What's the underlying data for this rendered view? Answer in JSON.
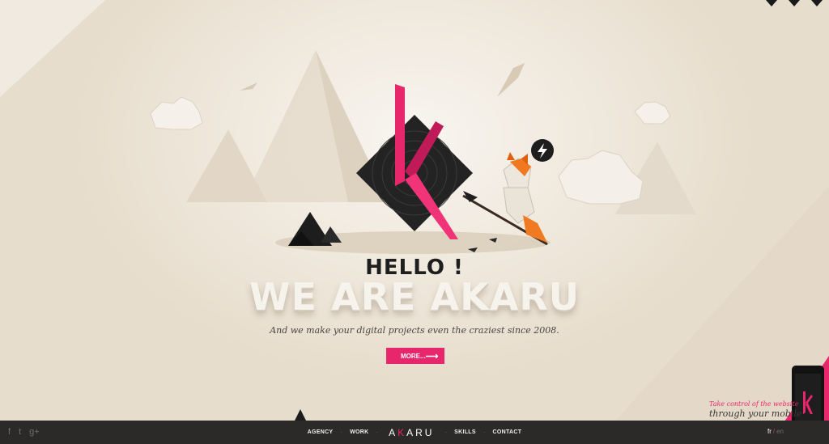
{
  "hero": {
    "greeting": "HELLO !",
    "headline": "WE ARE AKARU",
    "tagline": "And we make your digital projects even the craziest since 2008.",
    "more_label": "MORE...",
    "more_arrow": "⟶"
  },
  "promo": {
    "line1": "Take control of the website",
    "line2": "through your mobile"
  },
  "footer": {
    "social": [
      "f",
      "t",
      "g+"
    ],
    "nav": {
      "agency": "AGENCY",
      "work": "WORK",
      "brand_a": "A",
      "brand_k": "K",
      "brand_rest": "ARU",
      "skills": "SKILLS",
      "contact": "CONTACT",
      "separator": "·"
    },
    "lang": {
      "fr": "fr",
      "sep": "/",
      "en": "en"
    }
  },
  "colors": {
    "accent": "#e8266c",
    "footer_bg": "#2b2a29",
    "background": "#ede5d8"
  }
}
